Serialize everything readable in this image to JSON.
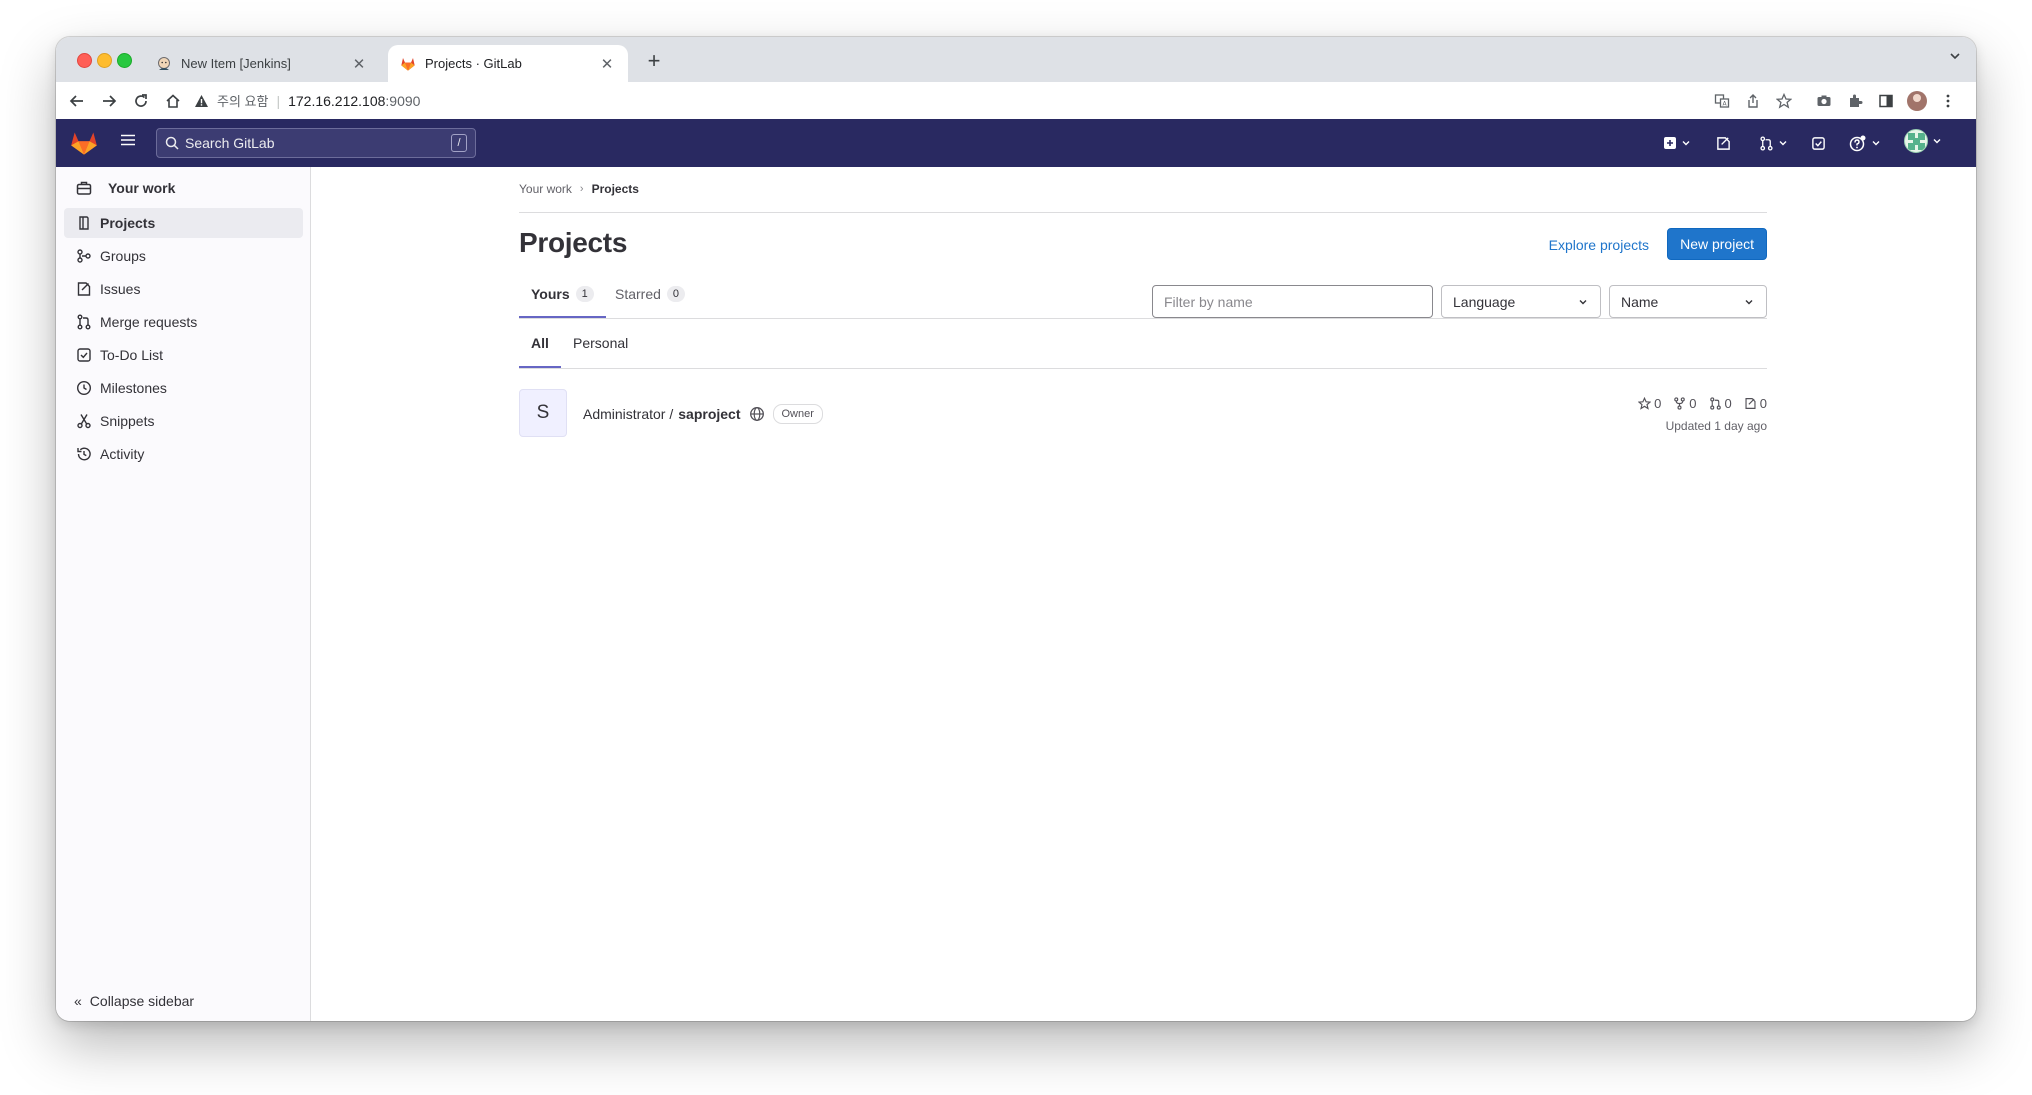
{
  "browser": {
    "tabs": [
      {
        "title": "New Item [Jenkins]",
        "favicon": "jenkins-icon",
        "active": false
      },
      {
        "title": "Projects · GitLab",
        "favicon": "gitlab-icon",
        "active": true
      }
    ],
    "address": {
      "security_label": "주의 요함",
      "host": "172.16.212.108",
      "port": ":9090"
    }
  },
  "header": {
    "search_placeholder": "Search GitLab",
    "search_shortcut": "/",
    "colors": {
      "bg": "#292961",
      "logo": "#fc6d26"
    }
  },
  "sidebar": {
    "context_title": "Your work",
    "items": [
      {
        "label": "Projects",
        "icon": "project-icon",
        "active": true
      },
      {
        "label": "Groups",
        "icon": "group-icon",
        "active": false
      },
      {
        "label": "Issues",
        "icon": "issues-icon",
        "active": false
      },
      {
        "label": "Merge requests",
        "icon": "merge-request-icon",
        "active": false
      },
      {
        "label": "To-Do List",
        "icon": "todo-icon",
        "active": false
      },
      {
        "label": "Milestones",
        "icon": "clock-icon",
        "active": false
      },
      {
        "label": "Snippets",
        "icon": "snippet-icon",
        "active": false
      },
      {
        "label": "Activity",
        "icon": "history-icon",
        "active": false
      }
    ],
    "collapse_label": "Collapse sidebar"
  },
  "main": {
    "breadcrumb": {
      "parent": "Your work",
      "current": "Projects"
    },
    "title": "Projects",
    "explore_label": "Explore projects",
    "new_project_label": "New project",
    "tabs": [
      {
        "label": "Yours",
        "count": "1",
        "active": true
      },
      {
        "label": "Starred",
        "count": "0",
        "active": false
      }
    ],
    "filter_placeholder": "Filter by name",
    "language_select": "Language",
    "sort_select": "Name",
    "subtabs": [
      {
        "label": "All",
        "active": true
      },
      {
        "label": "Personal",
        "active": false
      }
    ],
    "projects": [
      {
        "avatar_letter": "S",
        "namespace": "Administrator /",
        "name": "saproject",
        "visibility_icon": "globe-icon",
        "role": "Owner",
        "stars": "0",
        "forks": "0",
        "merge_requests": "0",
        "issues": "0",
        "updated": "Updated 1 day ago"
      }
    ]
  }
}
